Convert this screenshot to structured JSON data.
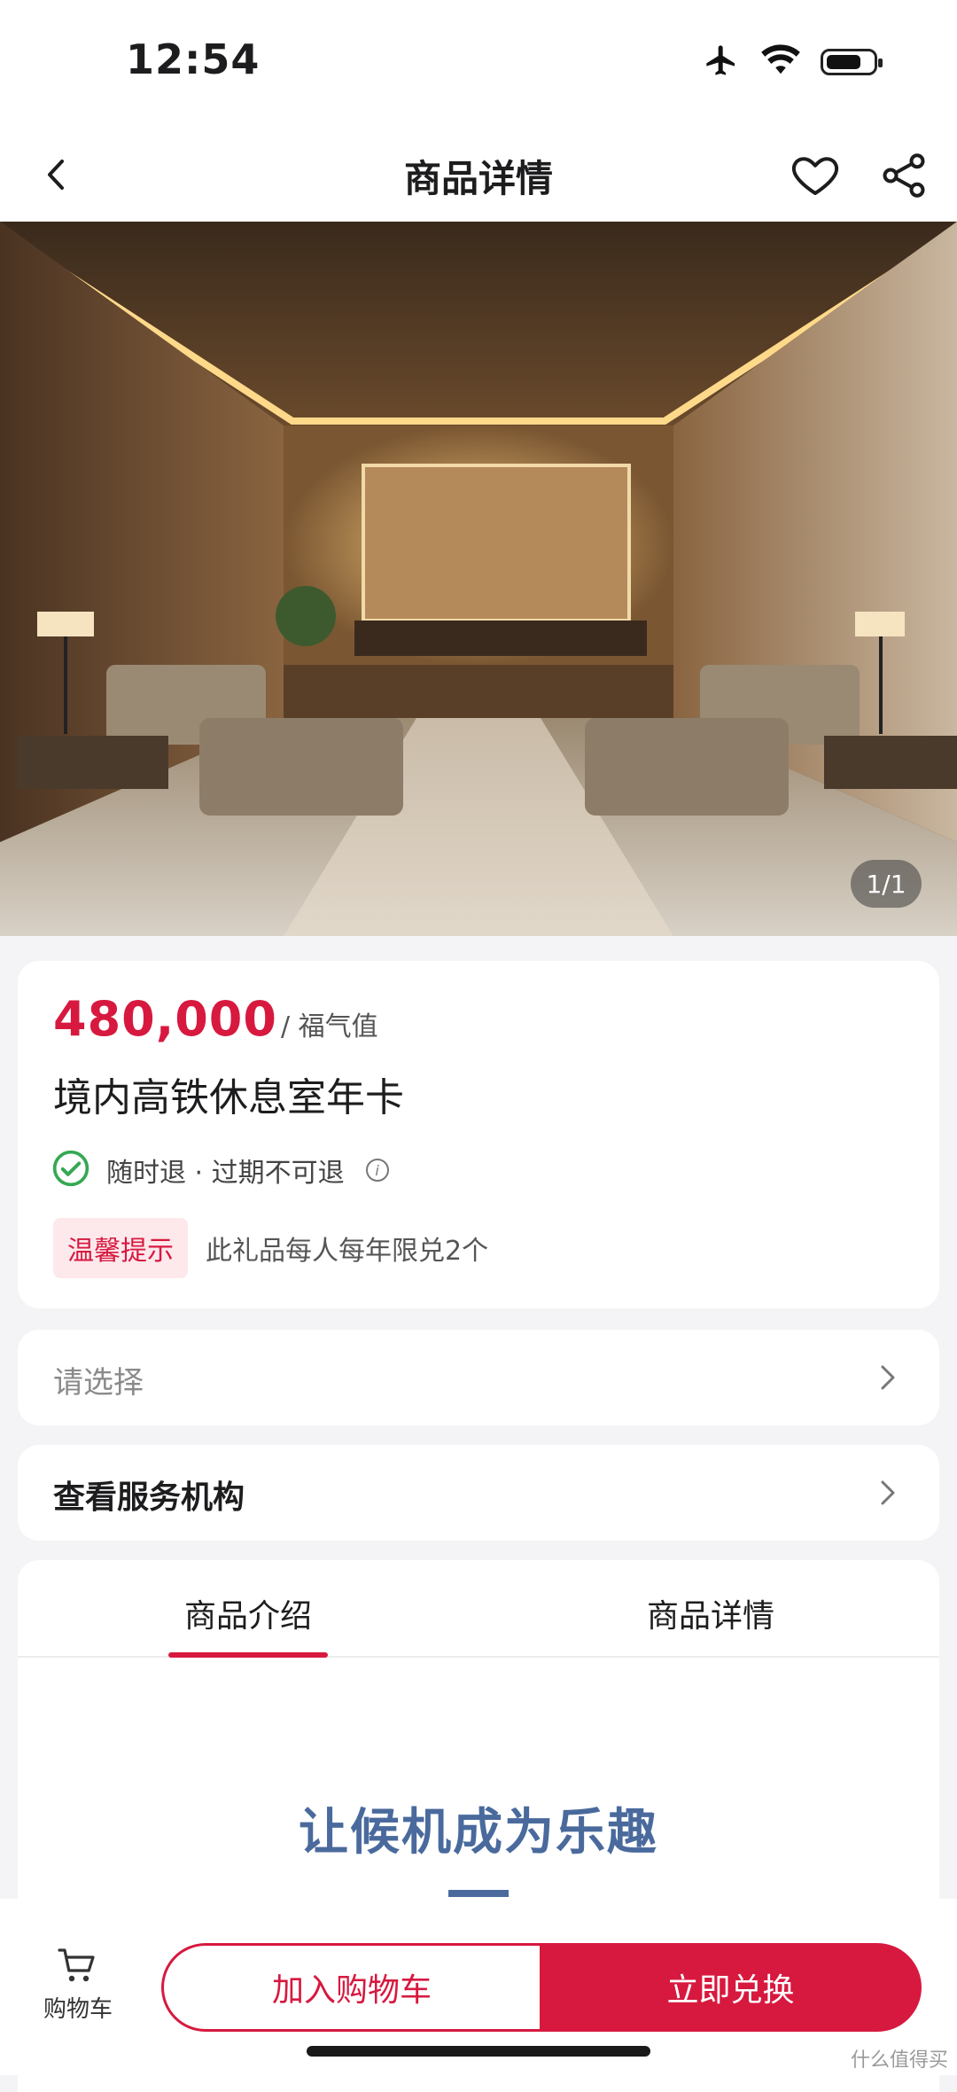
{
  "status_bar": {
    "time": "12:54",
    "battery_level": 0.75
  },
  "nav": {
    "title": "商品详情"
  },
  "hero": {
    "image_counter": "1/1"
  },
  "product": {
    "price": "480,000",
    "price_unit": "/ 福气值",
    "name": "境内高铁休息室年卡",
    "refund_policy": "随时退 · 过期不可退",
    "tip_badge": "温馨提示",
    "tip_text": "此礼品每人每年限兑2个"
  },
  "select": {
    "label": "请选择"
  },
  "service": {
    "label": "查看服务机构"
  },
  "tabs": [
    {
      "label": "商品介绍",
      "active": true
    },
    {
      "label": "商品详情",
      "active": false
    }
  ],
  "intro": {
    "heading": "让候机成为乐趣"
  },
  "bottom": {
    "cart_label": "购物车",
    "add_to_cart": "加入购物车",
    "buy_now": "立即兑换"
  },
  "watermark": "什么值得买",
  "colors": {
    "accent": "#d7193f",
    "intro_blue": "#4a6a9d"
  }
}
